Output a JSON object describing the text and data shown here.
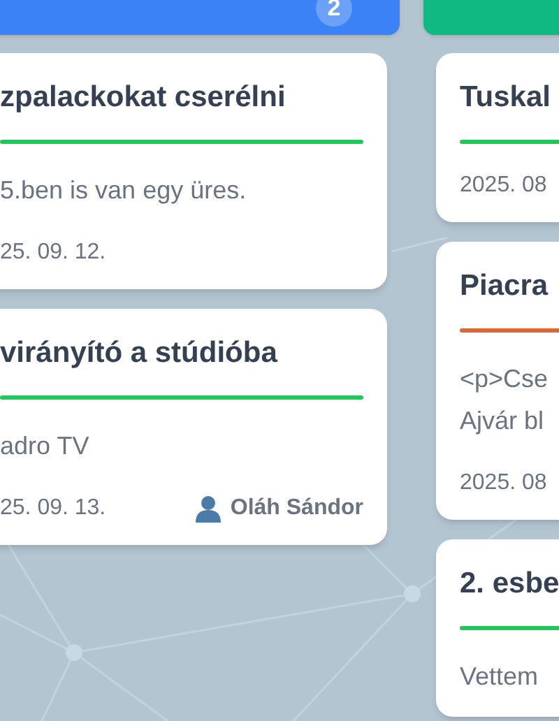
{
  "columns": [
    {
      "color": "#3b82f6",
      "badge": "2",
      "cards": [
        {
          "title": "zpalackokat cserélni",
          "color": "#22c55e",
          "description_lines": [
            "5.ben is van egy üres."
          ],
          "date": "25. 09. 12."
        },
        {
          "title": "virányító a stúdióba",
          "color": "#22c55e",
          "description_lines": [
            "adro TV"
          ],
          "date": "25. 09. 13.",
          "assignee": "Oláh Sándor"
        }
      ]
    },
    {
      "color": "#10b981",
      "cards": [
        {
          "title": "Tuskal",
          "color": "#22c55e",
          "date": "2025. 08"
        },
        {
          "title": "Piacra",
          "color": "#d9693b",
          "description_lines": [
            "<p>Cse",
            "Ajvár bl"
          ],
          "date": "2025. 08"
        },
        {
          "title": "2. esbe",
          "color": "#22c55e",
          "description_lines": [
            "Vettem"
          ]
        }
      ]
    }
  ]
}
